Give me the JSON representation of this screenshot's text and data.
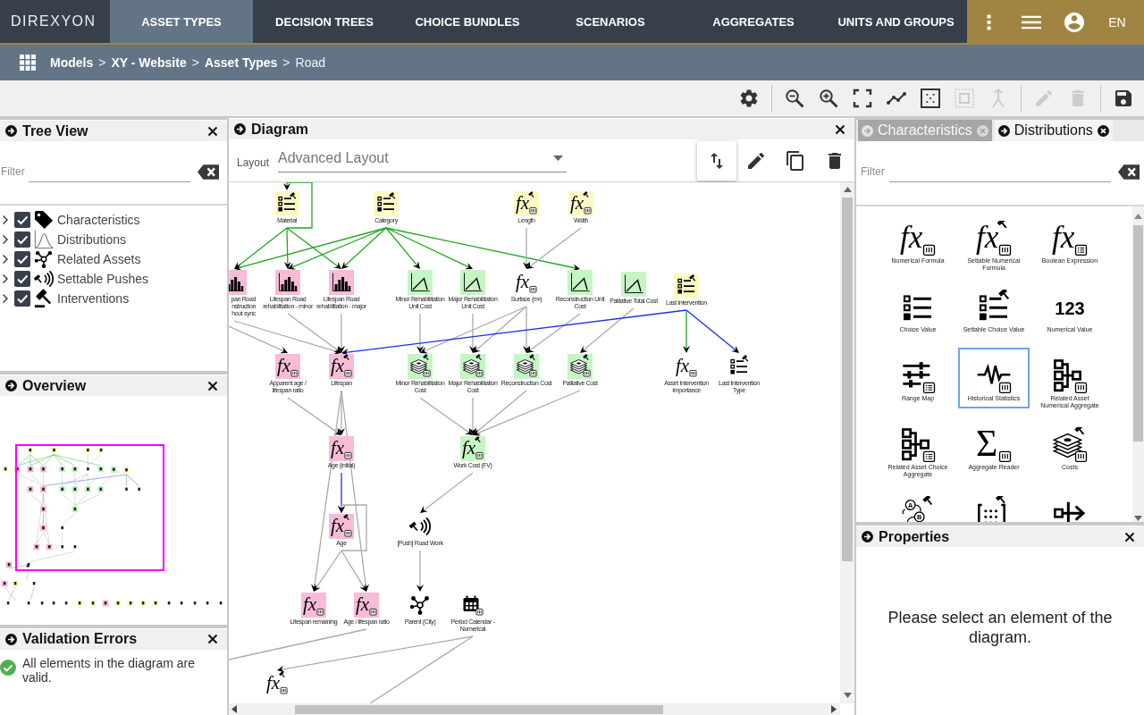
{
  "topbar": {
    "logo": "DIREXYON",
    "tabs": [
      {
        "label": "ASSET TYPES",
        "selected": true
      },
      {
        "label": "DECISION TREES",
        "selected": false
      },
      {
        "label": "CHOICE BUNDLES",
        "selected": false
      },
      {
        "label": "SCENARIOS",
        "selected": false
      },
      {
        "label": "AGGREGATES",
        "selected": false
      },
      {
        "label": "UNITS AND GROUPS",
        "selected": false
      }
    ],
    "language": "EN"
  },
  "breadcrumb": {
    "items": [
      {
        "label": "Models",
        "current": false
      },
      {
        "label": "XY - Website",
        "current": false
      },
      {
        "label": "Asset Types",
        "current": false
      },
      {
        "label": "Road",
        "current": true
      }
    ],
    "separators": [
      ">",
      ">",
      ">"
    ]
  },
  "toolbar": [
    {
      "kind": "settings",
      "disabled": false
    },
    {
      "kind": "separator"
    },
    {
      "kind": "zoom-out",
      "disabled": false
    },
    {
      "kind": "zoom-in",
      "disabled": false
    },
    {
      "kind": "fit",
      "disabled": false
    },
    {
      "kind": "route",
      "disabled": false
    },
    {
      "kind": "select-area",
      "disabled": false
    },
    {
      "kind": "group",
      "disabled": true
    },
    {
      "kind": "merge",
      "disabled": true
    },
    {
      "kind": "separator"
    },
    {
      "kind": "edit",
      "disabled": true
    },
    {
      "kind": "delete",
      "disabled": true
    },
    {
      "kind": "separator"
    },
    {
      "kind": "save",
      "disabled": false
    }
  ],
  "tree_view": {
    "title": "Tree View",
    "filter": {
      "label": "Filter"
    },
    "items": [
      {
        "label": "Characteristics",
        "kind": "tag",
        "checked": true,
        "expanded": false
      },
      {
        "label": "Distributions",
        "kind": "curve",
        "checked": true,
        "expanded": false
      },
      {
        "label": "Related Assets",
        "kind": "network",
        "checked": true,
        "expanded": false
      },
      {
        "label": "Settable Pushes",
        "kind": "push",
        "checked": true,
        "expanded": false
      },
      {
        "label": "Interventions",
        "kind": "gavel",
        "checked": true,
        "expanded": false
      }
    ]
  },
  "overview": {
    "title": "Overview"
  },
  "validation": {
    "title": "Validation Errors",
    "message": "All elements in the diagram are valid."
  },
  "diagram": {
    "title": "Diagram",
    "layout": {
      "label": "Layout",
      "value": "Advanced Layout"
    },
    "tools": [
      {
        "kind": "swap",
        "selected": true
      },
      {
        "kind": "edit",
        "selected": false
      },
      {
        "kind": "copy",
        "selected": false
      },
      {
        "kind": "delete",
        "selected": false
      }
    ],
    "nodes": [
      {
        "label": "Material",
        "kind": "choice-settable",
        "color": "#fdf9c4"
      },
      {
        "label": "Category",
        "kind": "choice-settable",
        "color": "#fdf9c4"
      },
      {
        "label": "Length",
        "kind": "formula-settable",
        "symbol": "fx",
        "color": "#fdf9c4"
      },
      {
        "label": "Width",
        "kind": "formula-settable",
        "symbol": "fx",
        "color": "#fdf9c4"
      },
      {
        "label": "pan Road nstruction hout sync",
        "kind": "histogram",
        "color": "#f8bbd8"
      },
      {
        "label": "Lifespan Road rehabilitation - minor",
        "kind": "histogram",
        "color": "#f8bbd8"
      },
      {
        "label": "Lifespan Road rehabilitation - major",
        "kind": "histogram",
        "color": "#f8bbd8"
      },
      {
        "label": "Minor Rehabilitation Unit Cost",
        "kind": "distribution",
        "color": "#c5f5c3"
      },
      {
        "label": "Major Rehabilitation Unit Cost",
        "kind": "distribution",
        "color": "#c5f5c3"
      },
      {
        "label": "Surface (m²)",
        "kind": "formula",
        "symbol": "fx"
      },
      {
        "label": "Reconstruction Unit Cost",
        "kind": "distribution",
        "color": "#c5f5c3"
      },
      {
        "label": "Palliative Total Cost",
        "kind": "distribution",
        "color": "#c5f5c3"
      },
      {
        "label": "Last Intervention",
        "kind": "choice-settable",
        "color": "#fdf9c4"
      },
      {
        "label": "Apparent age / lifespan ratio",
        "kind": "formula",
        "symbol": "fx",
        "color": "#f8bbd8"
      },
      {
        "label": "Lifespan",
        "kind": "formula-settable",
        "symbol": "fx",
        "color": "#f8bbd8"
      },
      {
        "label": "Minor Rehabilitation Cost",
        "kind": "costs",
        "color": "#c5f5c3"
      },
      {
        "label": "Major Rehabilitation Cost",
        "kind": "costs",
        "color": "#c5f5c3"
      },
      {
        "label": "Reconstruction Cost",
        "kind": "costs",
        "color": "#c5f5c3"
      },
      {
        "label": "Palliative Cost",
        "kind": "costs",
        "color": "#c5f5c3"
      },
      {
        "label": "Asset Intervention Importance",
        "kind": "formula",
        "symbol": "fx"
      },
      {
        "label": "Last Intervention Type",
        "kind": "choice-settable"
      },
      {
        "label": "Age (initial)",
        "kind": "formula",
        "symbol": "fx",
        "color": "#f8bbd8"
      },
      {
        "label": "Work Cost (FV)",
        "kind": "formula-settable",
        "symbol": "fx",
        "color": "#c5f5c3"
      },
      {
        "label": "Age",
        "kind": "formula-settable",
        "symbol": "fx",
        "color": "#f8bbd8"
      },
      {
        "label": "[Push] Road Work",
        "kind": "push"
      },
      {
        "label": "Lifespan remaining",
        "kind": "formula",
        "symbol": "fx",
        "color": "#f8bbd8"
      },
      {
        "label": "Age / lifespan ratio",
        "kind": "formula",
        "symbol": "fx",
        "color": "#f8bbd8"
      },
      {
        "label": "Parent (City)",
        "kind": "network"
      },
      {
        "label": "Period Calendar - Numerical",
        "kind": "calendar"
      },
      {
        "kind": "formula-settable",
        "symbol": "fx"
      }
    ],
    "edges": [
      {
        "color": "#1fa81f"
      },
      {
        "color": "#1fa81f"
      },
      {
        "color": "#1fa81f"
      },
      {
        "color": "#1fa81f"
      },
      {
        "color": "#1fa81f"
      },
      {
        "color": "#1fa81f"
      },
      {
        "color": "#1fa81f"
      },
      {
        "color": "#1fa81f"
      },
      {
        "color": "#1fa81f"
      },
      {
        "color": "#1fa81f"
      },
      {
        "color": "#aaaaaa"
      },
      {
        "color": "#aaaaaa"
      },
      {
        "color": "#aaaaaa"
      },
      {
        "color": "#aaaaaa"
      },
      {
        "color": "#aaaaaa"
      },
      {
        "color": "#aaaaaa"
      },
      {
        "color": "#aaaaaa"
      },
      {
        "color": "#aaaaaa"
      },
      {
        "color": "#aaaaaa"
      },
      {
        "color": "#aaaaaa"
      },
      {
        "color": "#aaaaaa"
      },
      {
        "color": "#aaaaaa"
      },
      {
        "color": "#aaaaaa"
      },
      {
        "color": "#1a2ef0"
      },
      {
        "color": "#1fa81f"
      },
      {
        "color": "#1a2ef0"
      },
      {
        "color": "#aaaaaa"
      },
      {
        "color": "#aaaaaa"
      },
      {
        "color": "#aaaaaa"
      },
      {
        "color": "#aaaaaa"
      },
      {
        "color": "#aaaaaa"
      },
      {
        "color": "#aaaaaa"
      },
      {
        "color": "#aaaaaa"
      },
      {
        "color": "#aaaaaa"
      },
      {
        "color": "#1a2ef0"
      },
      {
        "color": "#aaaaaa"
      },
      {
        "color": "#aaaaaa"
      },
      {
        "color": "#aaaaaa"
      },
      {
        "color": "#aaaaaa"
      },
      {
        "color": "#aaaaaa"
      },
      {
        "color": "#aaaaaa"
      },
      {
        "color": "#aaaaaa"
      },
      {
        "color": "#aaaaaa"
      }
    ]
  },
  "palette": {
    "tabs": [
      {
        "label": "Characteristics",
        "selected": false
      },
      {
        "label": "Distributions",
        "selected": true
      }
    ],
    "filter": {
      "label": "Filter"
    },
    "items": [
      {
        "label": "Numerical Formula",
        "kind": "formula",
        "symbol": "fx",
        "selected": false
      },
      {
        "label": "Settable Numerical Formula",
        "kind": "formula-settable",
        "symbol": "fx",
        "selected": false
      },
      {
        "label": "Boolean Expression",
        "kind": "boolean",
        "symbol": "fx",
        "selected": false
      },
      {
        "label": "Choice Value",
        "kind": "choice",
        "selected": false
      },
      {
        "label": "Settable Choice Value",
        "kind": "choice-settable",
        "selected": false
      },
      {
        "label": "Numerical Value",
        "kind": "number",
        "symbol": "123",
        "selected": false
      },
      {
        "label": "Range Map",
        "kind": "range-map",
        "selected": false
      },
      {
        "label": "Historical Statistics",
        "kind": "historical",
        "selected": true
      },
      {
        "label": "Related Asset Numerical Aggregate",
        "kind": "aggregate-numerical",
        "selected": false
      },
      {
        "label": "Related Asset Choice Aggregate",
        "kind": "aggregate-choice",
        "selected": false
      },
      {
        "label": "Aggregate Reader",
        "kind": "aggregate-reader",
        "symbol": "Σ",
        "selected": false
      },
      {
        "label": "Costs",
        "kind": "costs",
        "selected": false
      },
      {
        "kind": "state-chart",
        "symbols": [
          "A",
          "B"
        ],
        "selected": false
      },
      {
        "kind": "matrix",
        "selected": false
      },
      {
        "kind": "split",
        "selected": false
      }
    ]
  },
  "properties": {
    "title": "Properties",
    "message": "Please select an element of the diagram."
  }
}
